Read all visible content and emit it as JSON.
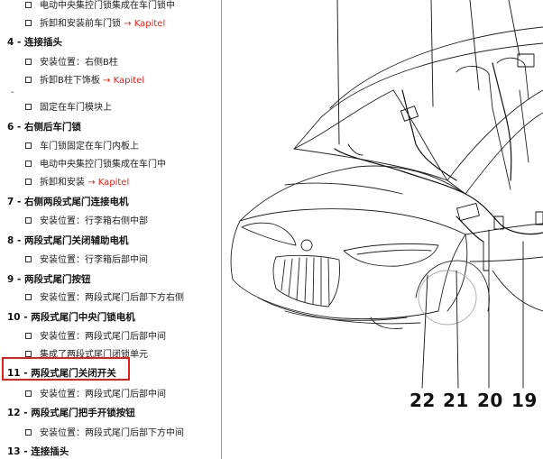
{
  "left": {
    "rows": [
      {
        "type": "sub",
        "text": "电动中央集控门锁集成在车门锁中"
      },
      {
        "type": "sub",
        "text": "拆卸和安装前车门锁",
        "link": "→ Kapitel"
      },
      {
        "type": "head",
        "text": "4 - 连接插头"
      },
      {
        "type": "sub",
        "text": "安装位置：右侧B柱"
      },
      {
        "type": "sub",
        "text": "拆卸B柱下饰板",
        "link": "→ Kapitel"
      },
      {
        "type": "dash",
        "text": "-"
      },
      {
        "type": "sub",
        "text": "固定在车门模块上"
      },
      {
        "type": "head",
        "text": "6 - 右侧后车门锁"
      },
      {
        "type": "sub",
        "text": "车门锁固定在车门内板上"
      },
      {
        "type": "sub",
        "text": "电动中央集控门锁集成在车门中"
      },
      {
        "type": "sub",
        "text": "拆卸和安装",
        "link": "→ Kapitel"
      },
      {
        "type": "head",
        "text": "7 - 右侧两段式尾门连接电机"
      },
      {
        "type": "sub",
        "text": "安装位置：行李箱右侧中部"
      },
      {
        "type": "head",
        "text": "8 - 两段式尾门关闭辅助电机"
      },
      {
        "type": "sub",
        "text": "安装位置：行李箱后部中间"
      },
      {
        "type": "head",
        "text": "9 - 两段式尾门按钮"
      },
      {
        "type": "sub",
        "text": "安装位置：两段式尾门后部下方右侧"
      },
      {
        "type": "head",
        "text": "10 - 两段式尾门中央门锁电机"
      },
      {
        "type": "sub",
        "text": "安装位置：两段式尾门后部中间"
      },
      {
        "type": "sub",
        "text": "集成了两段式尾门闭锁单元"
      },
      {
        "type": "head",
        "text": "11 - 两段式尾门关闭开关"
      },
      {
        "type": "sub",
        "text": "安装位置：两段式尾门后部中间"
      },
      {
        "type": "head",
        "text": "12 - 两段式尾门把手开锁按钮"
      },
      {
        "type": "sub",
        "text": "安装位置：两段式尾门后部下方中间"
      },
      {
        "type": "head",
        "text": "13 - 连接插头"
      }
    ]
  },
  "diagram": {
    "callouts": [
      "22",
      "21",
      "20",
      "19"
    ]
  },
  "colors": {
    "link": "#e0201b",
    "highlight": "#e0201b"
  }
}
